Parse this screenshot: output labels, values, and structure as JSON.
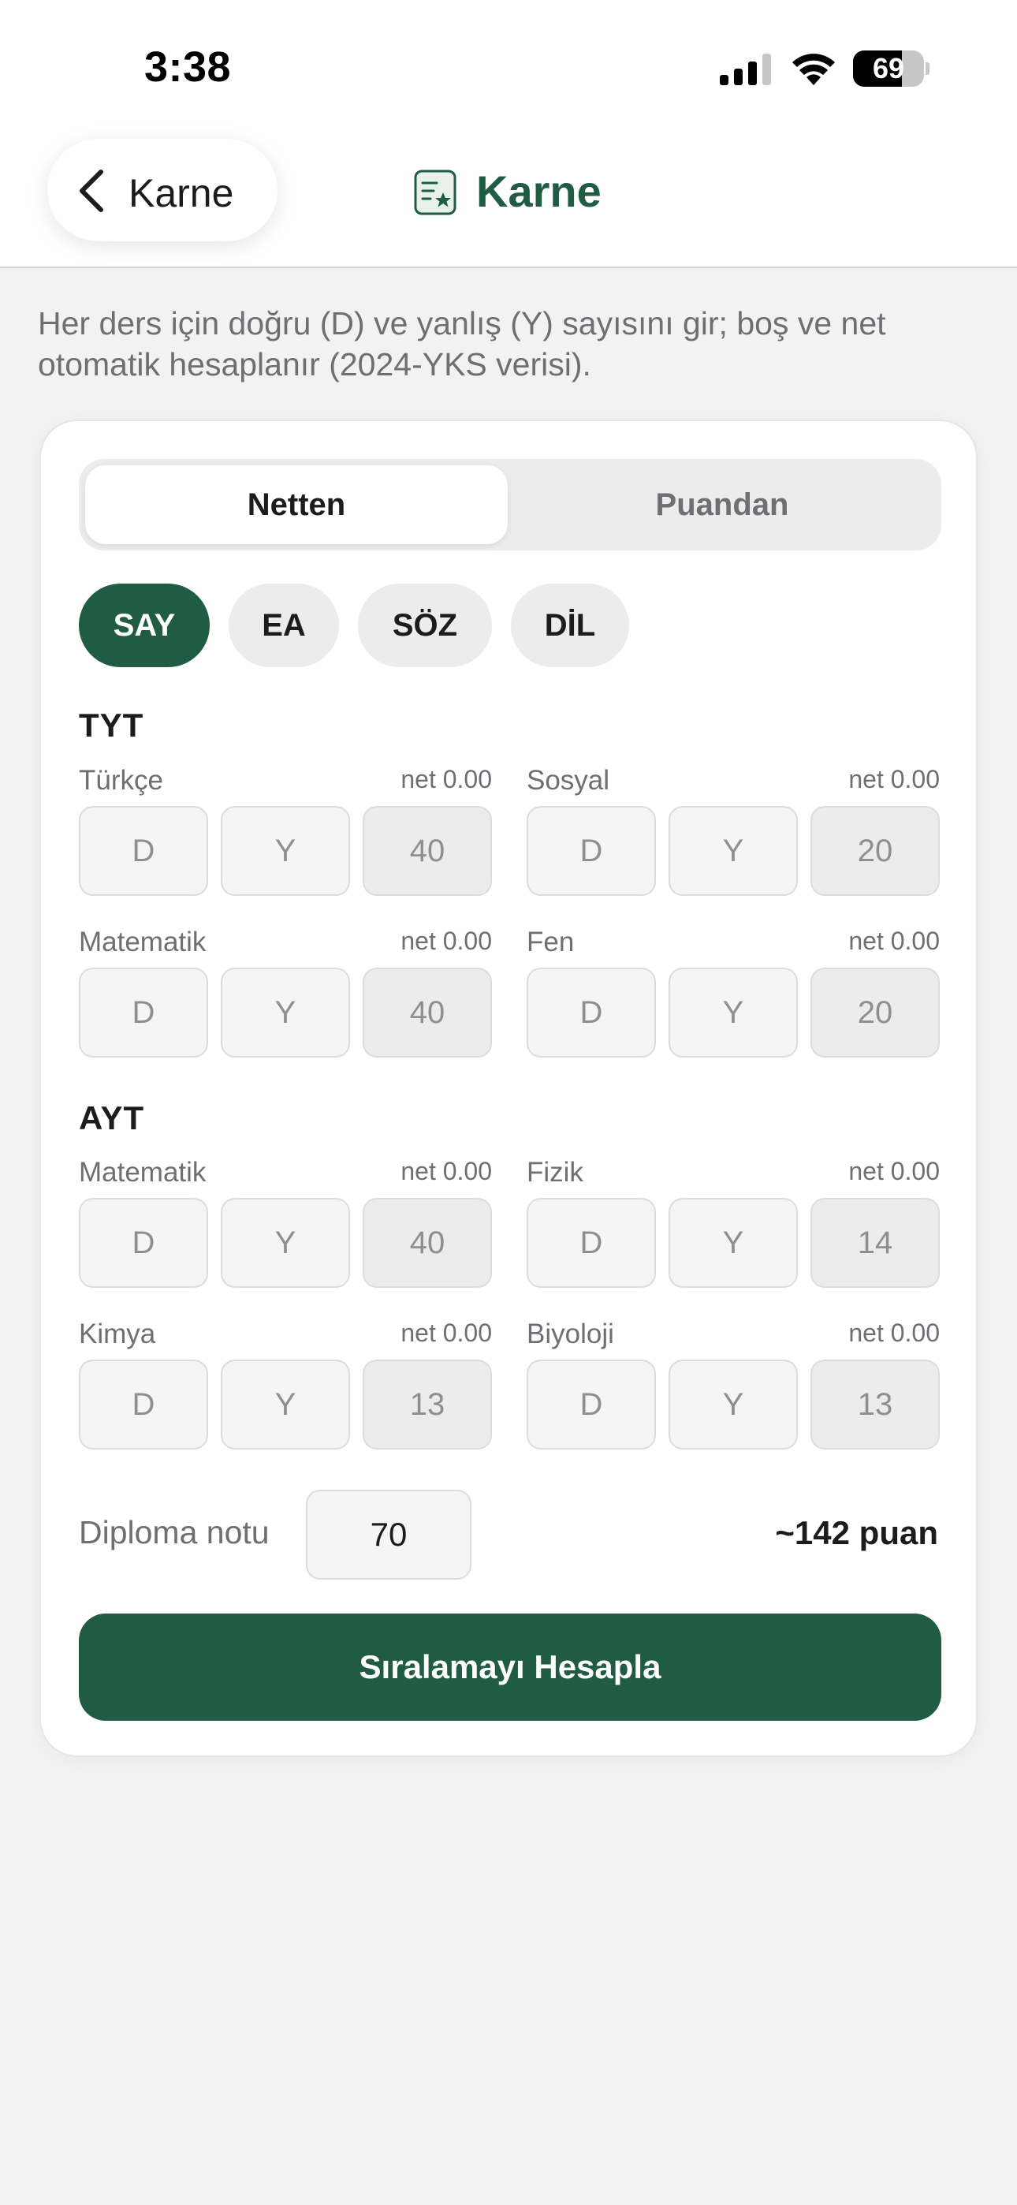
{
  "status_bar": {
    "time": "3:38",
    "battery": "69",
    "battery_level": 0.69
  },
  "nav": {
    "back_label": "Karne",
    "title": "Karne",
    "accent_color": "#1f5c43"
  },
  "description": "Her ders için doğru (D) ve yanlış (Y) sayısını gir; boş ve net otomatik hesaplanır (2024-YKS verisi).",
  "segments": {
    "active": "Netten",
    "inactive": "Puandan"
  },
  "chips": [
    {
      "label": "SAY",
      "active": true
    },
    {
      "label": "EA",
      "active": false
    },
    {
      "label": "SÖZ",
      "active": false
    },
    {
      "label": "DİL",
      "active": false
    }
  ],
  "field_placeholders": {
    "correct": "D",
    "wrong": "Y"
  },
  "tyt": {
    "title": "TYT",
    "subjects": [
      {
        "name": "Türkçe",
        "net": "net 0.00",
        "total": "40"
      },
      {
        "name": "Sosyal",
        "net": "net 0.00",
        "total": "20"
      },
      {
        "name": "Matematik",
        "net": "net 0.00",
        "total": "40"
      },
      {
        "name": "Fen",
        "net": "net 0.00",
        "total": "20"
      }
    ]
  },
  "ayt": {
    "title": "AYT",
    "subjects": [
      {
        "name": "Matematik",
        "net": "net 0.00",
        "total": "40"
      },
      {
        "name": "Fizik",
        "net": "net 0.00",
        "total": "14"
      },
      {
        "name": "Kimya",
        "net": "net 0.00",
        "total": "13"
      },
      {
        "name": "Biyoloji",
        "net": "net 0.00",
        "total": "13"
      }
    ]
  },
  "diploma": {
    "label": "Diploma notu",
    "value": "70"
  },
  "score_estimate": "~142 puan",
  "submit_label": "Sıralamayı Hesapla"
}
